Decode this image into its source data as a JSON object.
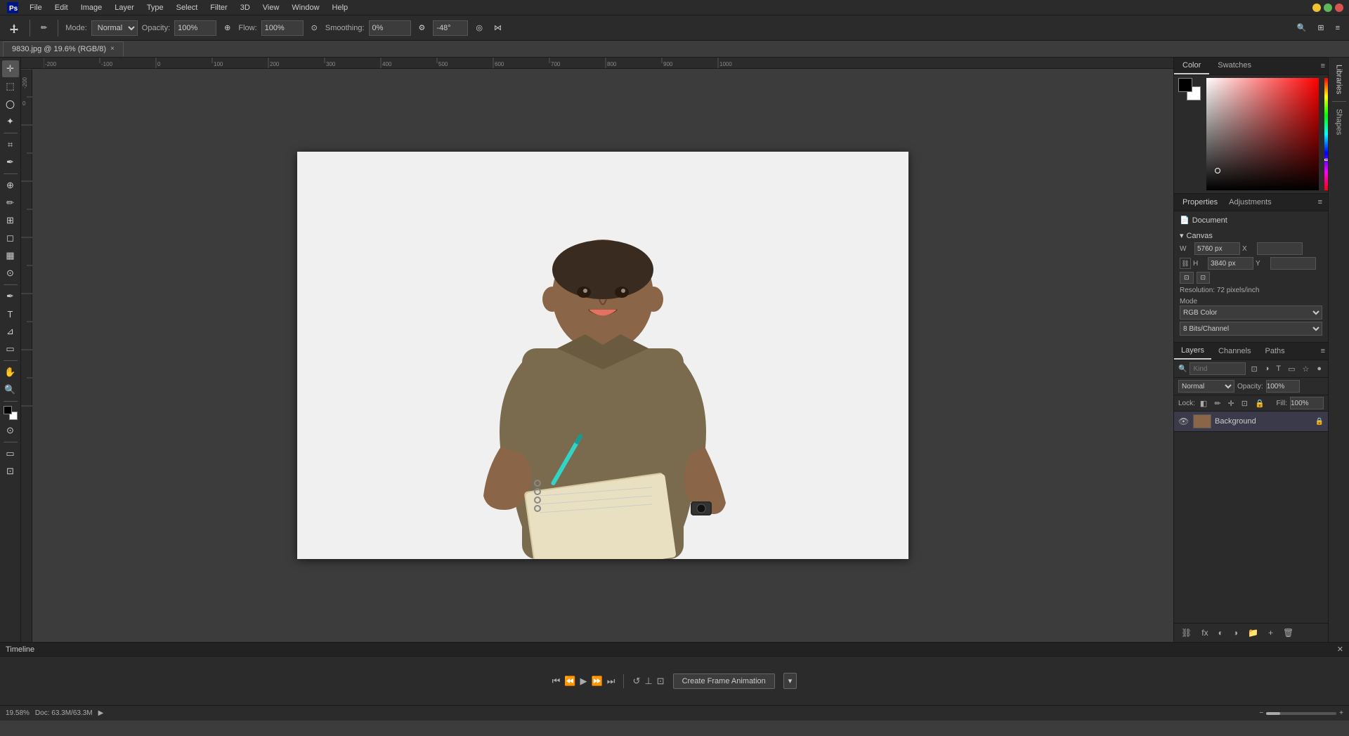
{
  "app": {
    "title": "Adobe Photoshop",
    "window_controls": [
      "minimize",
      "maximize",
      "close"
    ]
  },
  "menubar": {
    "items": [
      "PS",
      "File",
      "Edit",
      "Image",
      "Layer",
      "Type",
      "Select",
      "Filter",
      "3D",
      "View",
      "Window",
      "Help"
    ]
  },
  "toolbar": {
    "mode_label": "Mode:",
    "mode_value": "Normal",
    "opacity_label": "Opacity:",
    "opacity_value": "100%",
    "flow_label": "Flow:",
    "flow_value": "100%",
    "smoothing_label": "Smoothing:",
    "smoothing_value": "0%",
    "angle_value": "-48°"
  },
  "tab": {
    "filename": "9830.jpg @ 19.6% (RGB/8)",
    "close": "×"
  },
  "color_panel": {
    "tabs": [
      "Color",
      "Swatches"
    ],
    "active_tab": "Color"
  },
  "properties_panel": {
    "tabs": [
      "Properties",
      "Adjustments"
    ],
    "active_tab": "Properties",
    "document_label": "Document",
    "canvas_section": "Canvas",
    "width_label": "W",
    "width_value": "5760 px",
    "height_label": "H",
    "height_value": "3840 px",
    "x_label": "X",
    "y_label": "Y",
    "resolution_label": "Resolution:",
    "resolution_value": "72 pixels/inch",
    "mode_label": "Mode",
    "mode_value": "RGB Color",
    "depth_value": "8 Bits/Channel"
  },
  "layers_panel": {
    "tabs": [
      "Layers",
      "Channels",
      "Paths"
    ],
    "active_tab": "Layers",
    "search_placeholder": "Kind",
    "blend_mode": "Normal",
    "opacity_label": "Opacity:",
    "opacity_value": "100%",
    "fill_label": "Fill:",
    "fill_value": "100%",
    "lock_label": "Lock:",
    "layers": [
      {
        "name": "Background",
        "visible": true,
        "locked": true
      }
    ]
  },
  "timeline": {
    "title": "Timeline",
    "create_btn": "Create Frame Animation",
    "dropdown_arrow": "▾"
  },
  "statusbar": {
    "zoom": "19.58%",
    "doc_info": "Doc: 63.3M/63.3M"
  },
  "libraries_panel": {
    "title": "Libraries"
  },
  "shapes_panel": {
    "title": "Shapes"
  }
}
